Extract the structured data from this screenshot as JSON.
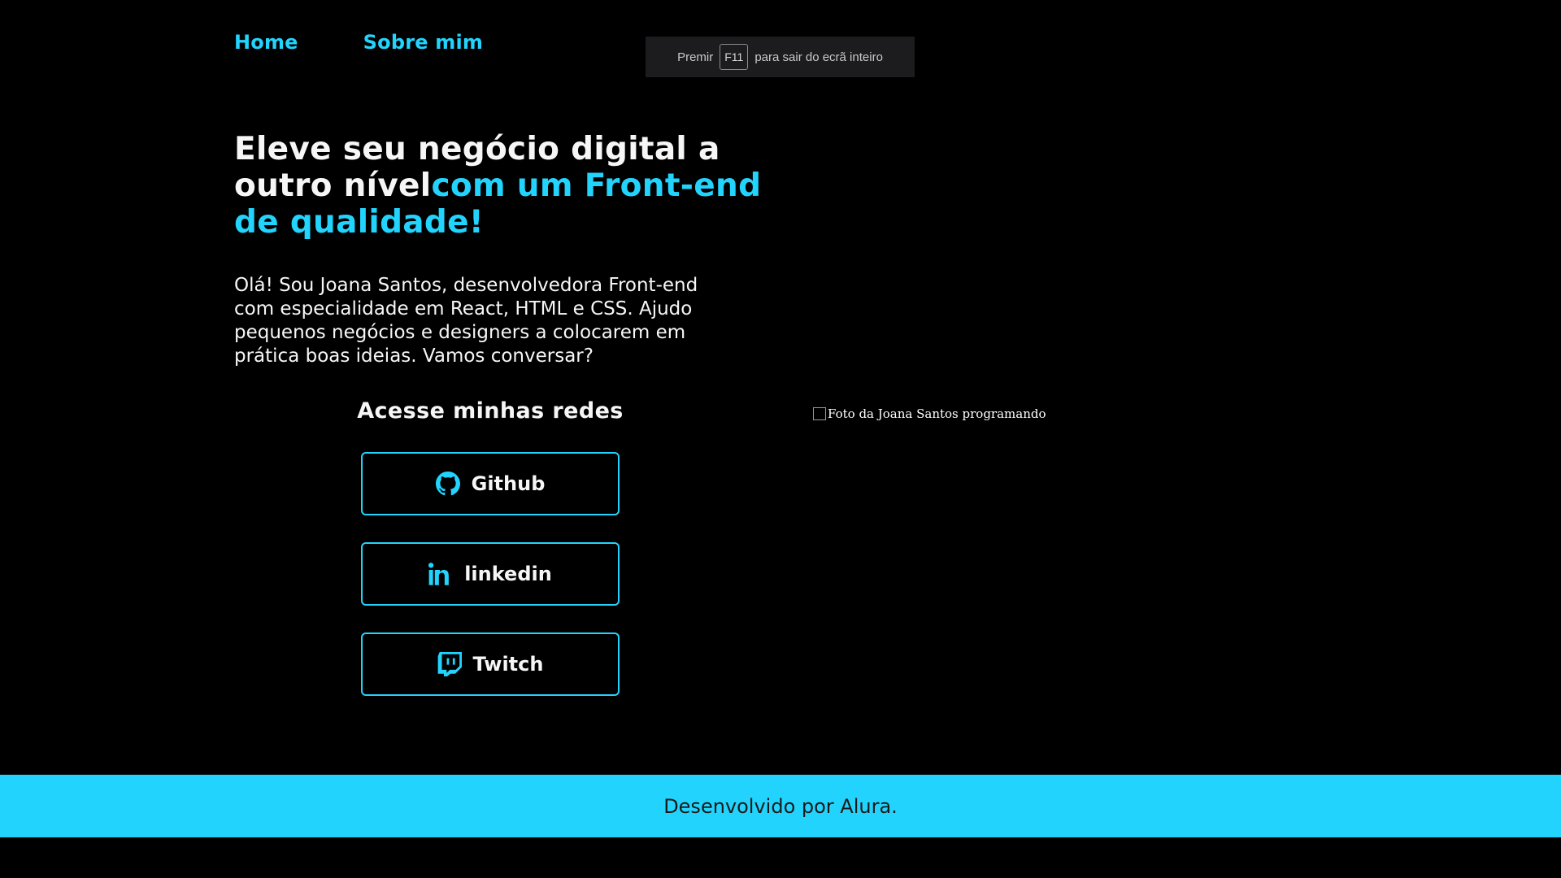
{
  "nav": {
    "items": [
      {
        "label": "Home"
      },
      {
        "label": "Sobre mim"
      }
    ]
  },
  "fullscreen_notice": {
    "prefix": "Premir",
    "key": "F11",
    "suffix": "para sair do ecrã inteiro"
  },
  "hero": {
    "headline_white": "Eleve seu negócio digital a outro nível",
    "headline_accent": "com um Front-end de qualidade!",
    "intro": "Olá! Sou Joana Santos, desenvolvedora Front-end com especialidade em React, HTML e CSS. Ajudo pequenos negócios e designers a colocarem em prática boas ideias. Vamos conversar?"
  },
  "social": {
    "title": "Acesse minhas redes",
    "links": [
      {
        "label": "Github",
        "icon": "github-icon"
      },
      {
        "label": "linkedin",
        "icon": "linkedin-icon"
      },
      {
        "label": "Twitch",
        "icon": "twitch-icon"
      }
    ]
  },
  "photo": {
    "alt": "Foto da Joana Santos programando"
  },
  "footer": {
    "text": "Desenvolvido por Alura."
  },
  "colors": {
    "accent": "#22d4fd",
    "background": "#000000",
    "text": "#f6f6f6"
  }
}
